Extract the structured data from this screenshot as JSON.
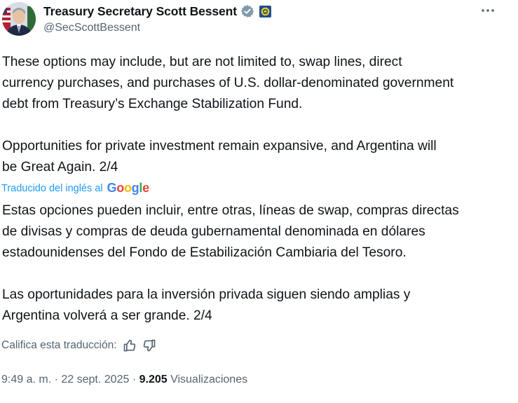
{
  "author": {
    "display_name": "Treasury Secretary Scott Bessent",
    "handle": "@SecScottBessent"
  },
  "more_icon": "more-horizontal-icon",
  "tweet": {
    "text": "These options may include, but are not limited to, swap lines, direct\ncurrency purchases, and purchases of U.S. dollar-denominated government\ndebt from Treasury’s Exchange Stabilization Fund.\n\nOpportunities for private investment remain expansive, and Argentina will\nbe Great Again. 2/4"
  },
  "translation": {
    "label": "Traducido del inglés al",
    "provider": "Google",
    "text": "Estas opciones pueden incluir, entre otras, líneas de swap, compras directas\nde divisas y compras de deuda gubernamental denominada en dólares\nestadounidenses del Fondo de Estabilización Cambiaria del Tesoro.\n\nLas oportunidades para la inversión privada siguen siendo amplias y\nArgentina volverá a ser grande. 2/4",
    "rate_label": "Califica esta traducción:"
  },
  "meta": {
    "time": "9:49 a. m.",
    "separator": "·",
    "date": "22 sept. 2025",
    "views_count": "9.205",
    "views_label": "Visualizaciones"
  },
  "colors": {
    "accent": "#1d9bf0",
    "text": "#0f1419",
    "secondary": "#536471",
    "verified_badge": "#829aab"
  }
}
